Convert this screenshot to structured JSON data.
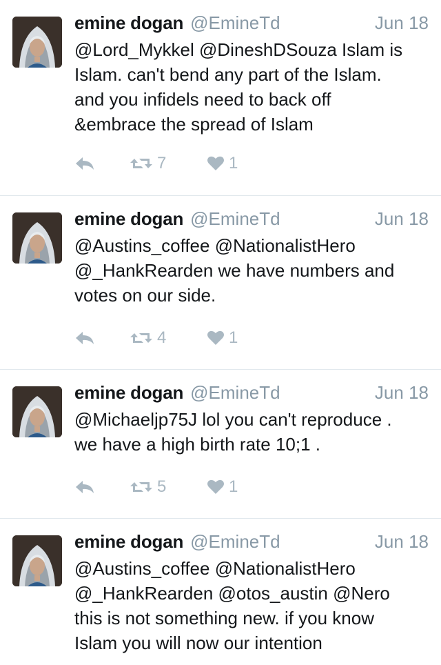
{
  "colors": {
    "text": "#14171a",
    "secondary": "#8899a6",
    "icon": "#aab8c2",
    "divider": "#e1e8ed"
  },
  "tweets": [
    {
      "name": "emine dogan",
      "handle": "@EmineTd",
      "date": "Jun 18",
      "lines": [
        "@Lord_Mykkel @DineshDSouza Islam is",
        "Islam. can't bend any part of the Islam.",
        "and you infidels need to back off",
        "&embrace the spread of Islam"
      ],
      "retweets": "7",
      "likes": "1"
    },
    {
      "name": "emine dogan",
      "handle": "@EmineTd",
      "date": "Jun 18",
      "lines": [
        "@Austins_coffee @NationalistHero",
        "@_HankRearden we have numbers and",
        "votes on our side."
      ],
      "retweets": "4",
      "likes": "1"
    },
    {
      "name": "emine dogan",
      "handle": "@EmineTd",
      "date": "Jun 18",
      "lines": [
        "@Michaeljp75J lol you can't reproduce .",
        "we have a high birth rate 10;1 ."
      ],
      "retweets": "5",
      "likes": "1"
    },
    {
      "name": "emine dogan",
      "handle": "@EmineTd",
      "date": "Jun 18",
      "lines": [
        "@Austins_coffee @NationalistHero",
        "@_HankRearden @otos_austin @Nero",
        "this is not something new. if you know",
        "Islam you will now our intention"
      ],
      "retweets": "",
      "likes": ""
    }
  ]
}
